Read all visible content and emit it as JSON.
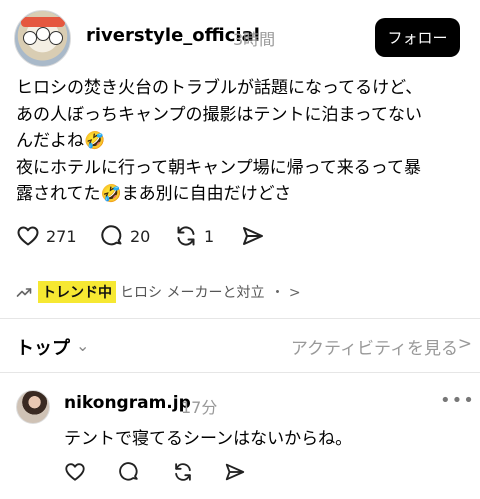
{
  "post": {
    "username": "riverstyle_official",
    "time": "3時間",
    "follow_label": "フォロー",
    "body_lines": [
      "ヒロシの焚き火台のトラブルが話題になってるけど、",
      "あの人ぼっちキャンプの撮影はテントに泊まってない",
      "んだよね🤣",
      "夜にホテルに行って朝キャンプ場に帰って来るって暴",
      "露されてた🤣まあ別に自由だけどさ"
    ],
    "likes": "271",
    "comments": "20",
    "reposts": "1",
    "icons": [
      "heart-icon",
      "comment-icon",
      "repost-icon",
      "share-icon"
    ]
  },
  "trend": {
    "badge": "トレンド中",
    "topic": "ヒロシ メーカーと対立",
    "more": "・ >",
    "icon": "trending-icon"
  },
  "sort": {
    "label": "トップ",
    "chevron": "⌄",
    "activity": "アクティビティを見る",
    "activity_chevron": ">"
  },
  "reply": {
    "username": "nikongram.jp",
    "time": "17分",
    "more": "•••",
    "text": "テントで寝てるシーンはないからね。"
  },
  "colors": {
    "accent_badge": "#f6e832",
    "follow_bg": "#000000",
    "muted_text": "#999999"
  }
}
